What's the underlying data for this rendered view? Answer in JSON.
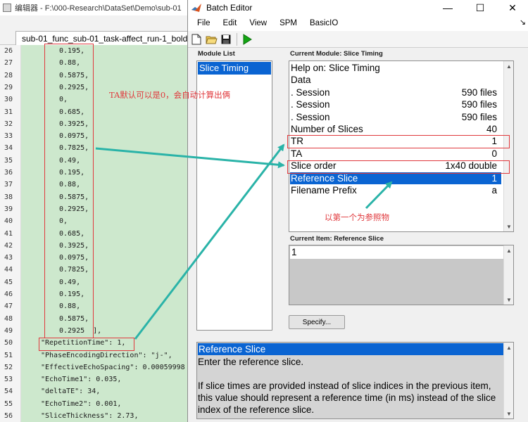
{
  "editor": {
    "title": "编辑器 - F:\\000-Research\\DataSet\\Demo\\sub-01",
    "tab_label": "sub-01_func_sub-01_task-affect_run-1_bold",
    "lines": [
      {
        "num": "26",
        "text": "0.195,",
        "indent": 1
      },
      {
        "num": "27",
        "text": "0.88,",
        "indent": 1
      },
      {
        "num": "28",
        "text": "0.5875,",
        "indent": 1
      },
      {
        "num": "29",
        "text": "0.2925,",
        "indent": 1
      },
      {
        "num": "30",
        "text": "0,",
        "indent": 1
      },
      {
        "num": "31",
        "text": "0.685,",
        "indent": 1
      },
      {
        "num": "32",
        "text": "0.3925,",
        "indent": 1
      },
      {
        "num": "33",
        "text": "0.0975,",
        "indent": 1
      },
      {
        "num": "34",
        "text": "0.7825,",
        "indent": 1
      },
      {
        "num": "35",
        "text": "0.49,",
        "indent": 1
      },
      {
        "num": "36",
        "text": "0.195,",
        "indent": 1
      },
      {
        "num": "37",
        "text": "0.88,",
        "indent": 1
      },
      {
        "num": "38",
        "text": "0.5875,",
        "indent": 1
      },
      {
        "num": "39",
        "text": "0.2925,",
        "indent": 1
      },
      {
        "num": "40",
        "text": "0,",
        "indent": 1
      },
      {
        "num": "41",
        "text": "0.685,",
        "indent": 1
      },
      {
        "num": "42",
        "text": "0.3925,",
        "indent": 1
      },
      {
        "num": "43",
        "text": "0.0975,",
        "indent": 1
      },
      {
        "num": "44",
        "text": "0.7825,",
        "indent": 1
      },
      {
        "num": "45",
        "text": "0.49,",
        "indent": 1
      },
      {
        "num": "46",
        "text": "0.195,",
        "indent": 1
      },
      {
        "num": "47",
        "text": "0.88,",
        "indent": 1
      },
      {
        "num": "48",
        "text": "0.5875,",
        "indent": 1
      },
      {
        "num": "49",
        "text": "0.2925  ],",
        "indent": 1
      },
      {
        "num": "50",
        "text": "\"RepetitionTime\": 1,",
        "indent": 0
      },
      {
        "num": "51",
        "text": "\"PhaseEncodingDirection\": \"j-\",",
        "indent": 0
      },
      {
        "num": "52",
        "text": "\"EffectiveEchoSpacing\": 0.00059998",
        "indent": 0
      },
      {
        "num": "53",
        "text": "\"EchoTime1\": 0.035,",
        "indent": 0
      },
      {
        "num": "54",
        "text": "\"deltaTE\": 34,",
        "indent": 0
      },
      {
        "num": "55",
        "text": "\"EchoTime2\": 0.001,",
        "indent": 0
      },
      {
        "num": "56",
        "text": "\"SliceThickness\": 2.73,",
        "indent": 0
      }
    ]
  },
  "batch": {
    "title": "Batch Editor",
    "window_controls": {
      "minimize": "—",
      "maximize": "☐",
      "close": "✕"
    },
    "menu": [
      "File",
      "Edit",
      "View",
      "SPM",
      "BasicIO"
    ],
    "menu_overflow": "↘",
    "module_list_label": "Module List",
    "module_list": [
      "Slice Timing"
    ],
    "current_module_label": "Current Module: Slice Timing",
    "current_module_rows": [
      {
        "label": "Help on: Slice Timing",
        "value": ""
      },
      {
        "label": "Data",
        "value": ""
      },
      {
        "label": ". Session",
        "value": "590 files"
      },
      {
        "label": ". Session",
        "value": "590 files"
      },
      {
        "label": ". Session",
        "value": "590 files"
      },
      {
        "label": "Number of Slices",
        "value": "40"
      },
      {
        "label": "TR",
        "value": "1"
      },
      {
        "label": "TA",
        "value": "0"
      },
      {
        "label": "Slice order",
        "value": "1x40 double"
      },
      {
        "label": "Reference Slice",
        "value": "1"
      },
      {
        "label": "Filename Prefix",
        "value": "a"
      }
    ],
    "selected_row_index": 9,
    "current_item_label": "Current Item: Reference Slice",
    "current_item_value": "1",
    "specify_label": "Specify...",
    "help_header": "Reference Slice",
    "help_lines": [
      "Enter the reference slice.",
      "",
      "If  slice  times are provided instead of slice indices in the previous item,",
      "this  value should represent a reference time (in ms) instead of the slice",
      "index of the reference slice."
    ]
  },
  "annotations": {
    "ta_note": "TA默认可以是0，会自动计算出俩",
    "ref_note": "以第一个为参照物",
    "color": "#e0383c",
    "arrow_color": "#2ab3a8"
  },
  "colors": {
    "selection": "#0a64d2",
    "code_bg": "#cde8cd"
  }
}
